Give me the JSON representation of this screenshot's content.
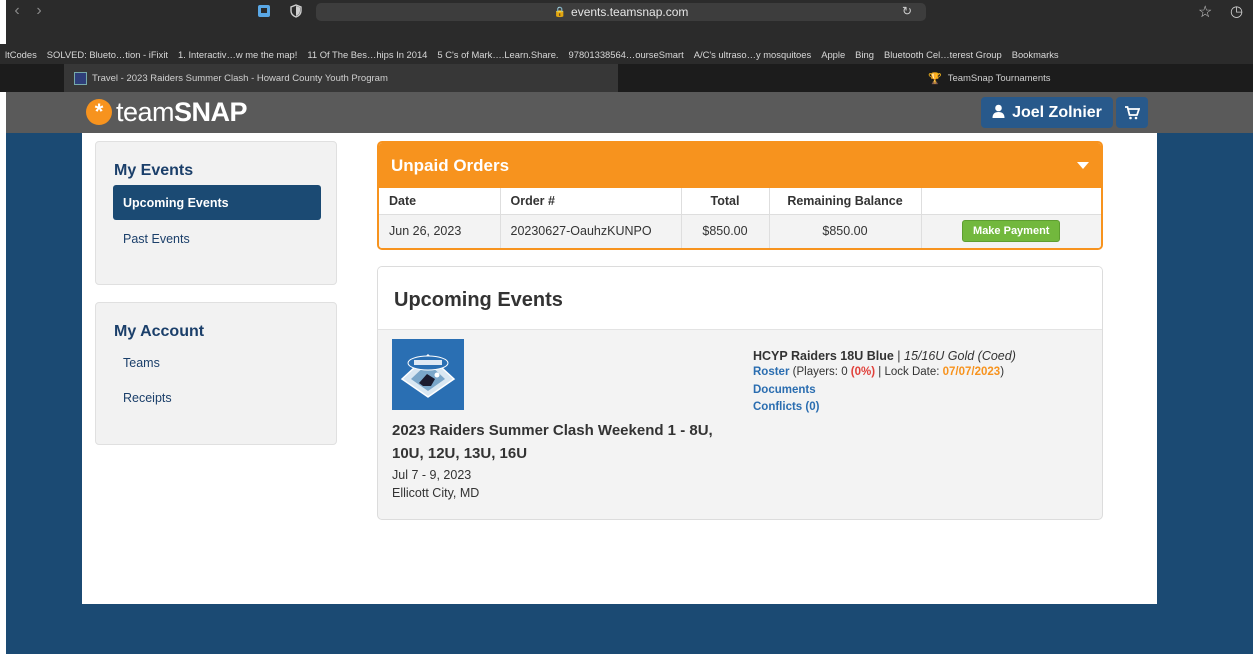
{
  "browser": {
    "url": "events.teamsnap.com",
    "bookmarks": [
      "ltCodes",
      "SOLVED: Blueto…tion - iFixit",
      "1. Interactiv…w me the map!",
      "11 Of The Bes…hips In 2014",
      "5 C's of Mark….Learn.Share.",
      "97801338564…ourseSmart",
      "A/C's ultraso…y mosquitoes",
      "Apple",
      "Bing",
      "Bluetooth Cel…terest Group",
      "Bookmarks"
    ],
    "tabs": [
      {
        "label": "Travel - 2023 Raiders Summer Clash - Howard County Youth Program",
        "active": true
      },
      {
        "label": "TeamSnap Tournaments",
        "active": false
      }
    ]
  },
  "header": {
    "logo_prefix": "team",
    "logo_suffix": "SNAP",
    "user_name": "Joel Zolnier"
  },
  "sidebar": {
    "events_title": "My Events",
    "events_items": [
      "Upcoming Events",
      "Past Events"
    ],
    "account_title": "My Account",
    "account_items": [
      "Teams",
      "Receipts"
    ]
  },
  "orders": {
    "title": "Unpaid Orders",
    "columns": [
      "Date",
      "Order #",
      "Total",
      "Remaining Balance",
      ""
    ],
    "rows": [
      {
        "date": "Jun 26, 2023",
        "order": "20230627-OauhzKUNPO",
        "total": "$850.00",
        "balance": "$850.00",
        "action": "Make Payment"
      }
    ]
  },
  "upcoming": {
    "title": "Upcoming Events",
    "event": {
      "name": "2023 Raiders Summer Clash Weekend 1 - 8U, 10U, 12U, 13U, 16U",
      "dates": "Jul 7 - 9, 2023",
      "location": "Ellicott City, MD",
      "team": "HCYP Raiders 18U Blue",
      "separator": " | ",
      "division": "15/16U Gold (Coed)",
      "roster_link": "Roster",
      "players_prefix": " (Players: 0 ",
      "players_pct": "(0%)",
      "lock_prefix": " | Lock Date: ",
      "lock_date": "07/07/2023",
      "lock_suffix": ")",
      "documents_link": "Documents",
      "conflicts_link": "Conflicts (0)"
    }
  },
  "colors": {
    "brand_orange": "#f7931e",
    "navy": "#1b4a73",
    "link_blue": "#2a6db0",
    "button_green": "#72b83d"
  }
}
